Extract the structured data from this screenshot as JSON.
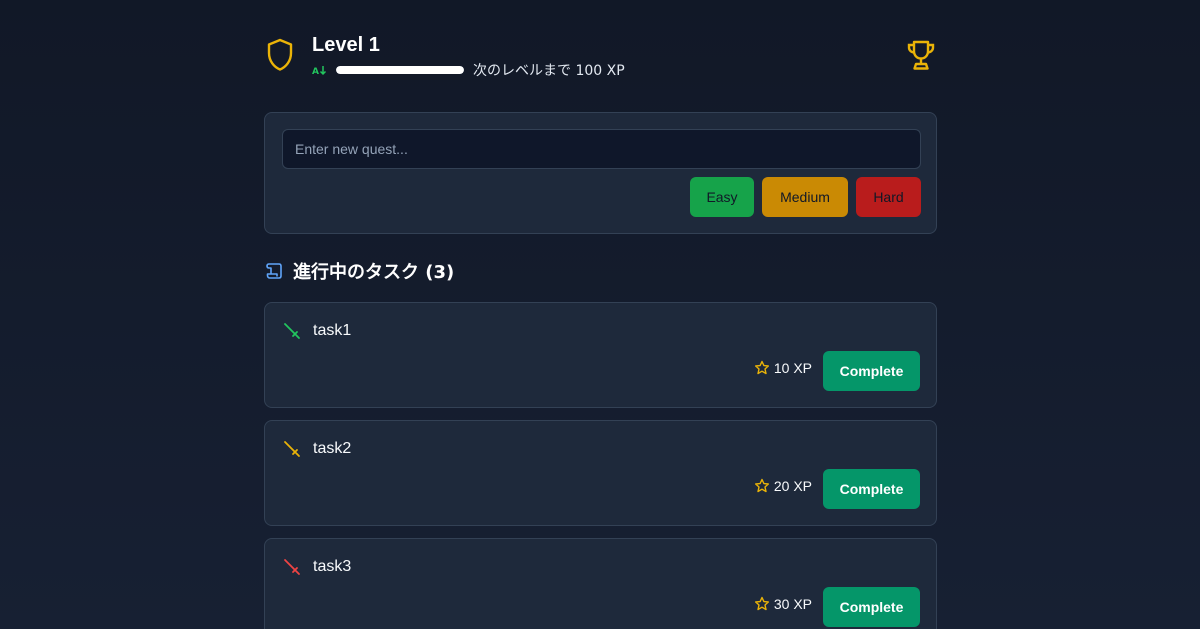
{
  "header": {
    "level_label": "Level 1",
    "xp_progress": 1.0,
    "xp_next_text": "次のレベルまで 100 XP",
    "level_icon": "shield-icon",
    "trophy_icon": "trophy-icon",
    "rank_icon": "az-sort-icon"
  },
  "quest_form": {
    "placeholder": "Enter new quest...",
    "value": "",
    "buttons": {
      "easy": "Easy",
      "medium": "Medium",
      "hard": "Hard"
    }
  },
  "tasks_section": {
    "title": "進行中のタスク (3)",
    "icon": "scroll-icon"
  },
  "tasks": [
    {
      "name": "task1",
      "xp": "10 XP",
      "difficulty_color": "#22c55e",
      "button": "Complete"
    },
    {
      "name": "task2",
      "xp": "20 XP",
      "difficulty_color": "#eab308",
      "button": "Complete"
    },
    {
      "name": "task3",
      "xp": "30 XP",
      "difficulty_color": "#ef4444",
      "button": "Complete"
    }
  ],
  "colors": {
    "accent": "#eab308",
    "complete": "#059669",
    "easy": "#16a34a",
    "medium": "#ca8a04",
    "hard": "#b91c1c"
  }
}
